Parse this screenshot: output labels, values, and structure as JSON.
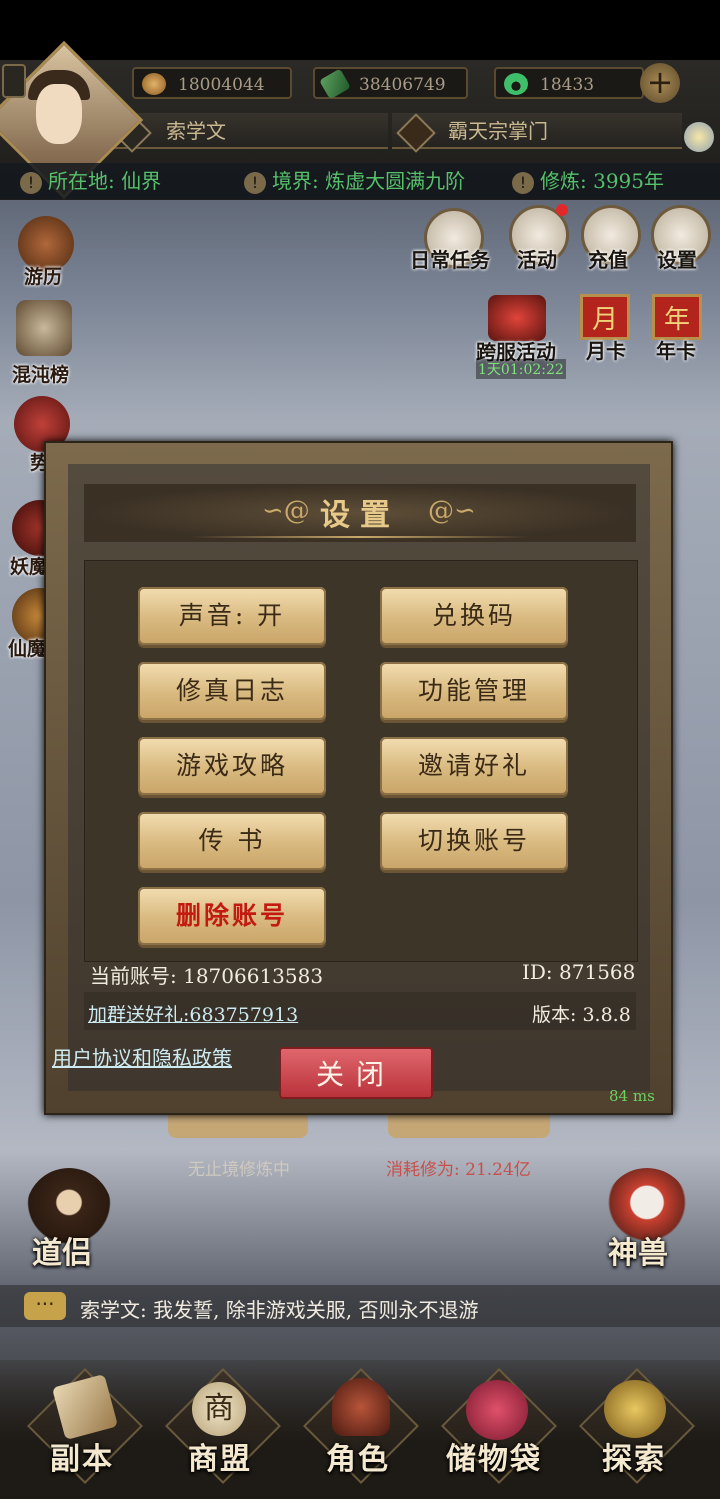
{
  "player": {
    "name": "索学文",
    "title": "霸天宗掌门",
    "location": "所在地: 仙界",
    "realm": "境界: 炼虚大圆满九阶",
    "cultivation": "修炼: 3995年"
  },
  "resources": [
    {
      "icon": "copper-coin-icon",
      "value": "18004044"
    },
    {
      "icon": "jade-stone-icon",
      "value": "38406749"
    },
    {
      "icon": "green-jade-icon",
      "value": "18433"
    }
  ],
  "top_menu": [
    {
      "icon": "daily-task-icon",
      "label": "日常任务"
    },
    {
      "icon": "activity-icon",
      "label": "活动"
    },
    {
      "icon": "recharge-icon",
      "label": "充值"
    },
    {
      "icon": "settings-icon",
      "label": "设置"
    }
  ],
  "event_menu": {
    "cross_server": {
      "label": "跨服活动",
      "timer": "1天01:02:22"
    },
    "monthly_card": {
      "label": "月卡",
      "badge": "月"
    },
    "yearly_card": {
      "label": "年卡",
      "badge": "年"
    }
  },
  "left_menu": [
    {
      "label": "游历"
    },
    {
      "label": "混沌榜"
    },
    {
      "label": "势"
    },
    {
      "label": "妖魔"
    },
    {
      "label": "仙魔"
    }
  ],
  "settings_dialog": {
    "title": "设置",
    "buttons_left": [
      "声音: 开",
      "修真日志",
      "游戏攻略",
      "传 书"
    ],
    "buttons_right": [
      "兑换码",
      "功能管理",
      "邀请好礼",
      "切换账号"
    ],
    "delete_label": "删除账号",
    "account_label": "当前账号: 18706613583",
    "id_label": "ID: 871568",
    "group_link": "加群送好礼:683757913",
    "version": "版本: 3.8.8",
    "policy_link": "用户协议和隐私政策",
    "close_label": "关闭",
    "latency": "84 ms"
  },
  "background_text": {
    "cultivating": "无止境修炼中",
    "consume": "消耗修为: 21.24亿"
  },
  "side_characters": {
    "left": "道侣",
    "right": "神兽"
  },
  "chat": {
    "message": "索学文: 我发誓, 除非游戏关服, 否则永不退游"
  },
  "bottom_nav": [
    {
      "icon": "dungeon-icon",
      "label": "副本"
    },
    {
      "icon": "guild-icon",
      "label": "商盟",
      "glyph": "商"
    },
    {
      "icon": "helmet-icon",
      "label": "角色"
    },
    {
      "icon": "bag-icon",
      "label": "储物袋"
    },
    {
      "icon": "explore-icon",
      "label": "探索"
    }
  ],
  "colors": {
    "status_green": "#56c06a",
    "button_gold": "#d8b97f",
    "close_red": "#b9323a",
    "delete_red": "#c21a10"
  }
}
